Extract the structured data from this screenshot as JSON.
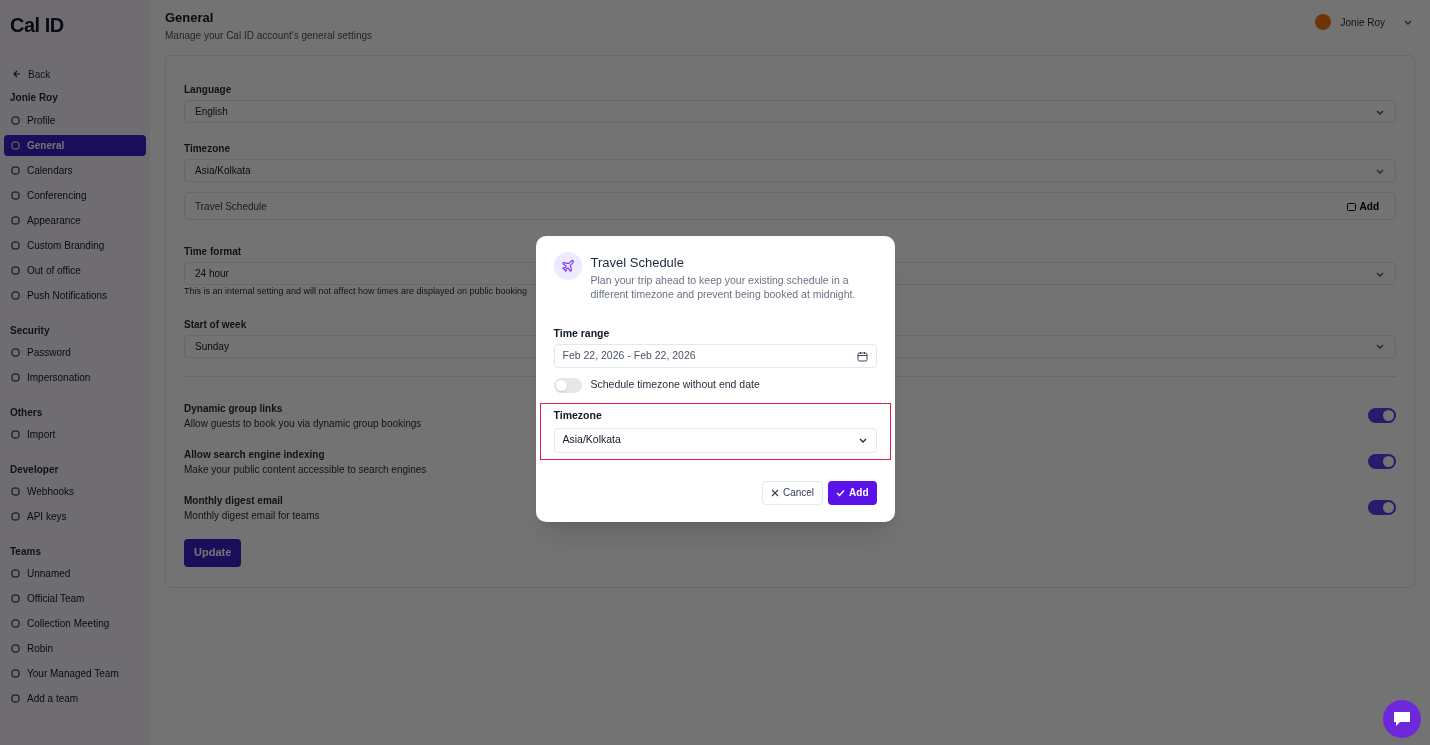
{
  "sidebar": {
    "logo": "Cal ID",
    "back": "Back",
    "user": "Jonie Roy",
    "sections": [
      {
        "items": [
          {
            "label": "Profile",
            "selected": false
          },
          {
            "label": "General",
            "selected": true
          },
          {
            "label": "Calendars",
            "selected": false
          },
          {
            "label": "Conferencing",
            "selected": false
          },
          {
            "label": "Appearance",
            "selected": false
          },
          {
            "label": "Custom Branding",
            "selected": false
          },
          {
            "label": "Out of office",
            "selected": false
          },
          {
            "label": "Push Notifications",
            "selected": false
          }
        ]
      },
      {
        "title": "Security",
        "items": [
          {
            "label": "Password",
            "selected": false
          },
          {
            "label": "Impersonation",
            "selected": false
          }
        ]
      },
      {
        "title": "Others",
        "items": [
          {
            "label": "Import",
            "selected": false
          }
        ]
      },
      {
        "title": "Developer",
        "items": [
          {
            "label": "Webhooks",
            "selected": false
          },
          {
            "label": "API keys",
            "selected": false
          }
        ]
      },
      {
        "title": "Teams",
        "items": [
          {
            "label": "Unnamed",
            "selected": false
          },
          {
            "label": "Official Team",
            "selected": false
          },
          {
            "label": "Collection Meeting",
            "selected": false
          },
          {
            "label": "Robin",
            "selected": false
          },
          {
            "label": "Your Managed Team",
            "selected": false
          },
          {
            "label": "Add a team",
            "selected": false
          }
        ]
      }
    ]
  },
  "header": {
    "title": "General",
    "subtitle": "Manage your Cal ID account's general settings",
    "user_name": "Jonie Roy"
  },
  "settings": [
    {
      "kind": "select",
      "label": "Language",
      "value": "English"
    },
    {
      "kind": "select",
      "label": "Timezone",
      "value": "Asia/Kolkata"
    },
    {
      "kind": "action_row",
      "label": "Travel Schedule",
      "button": "Add"
    },
    {
      "kind": "select",
      "label": "Time format",
      "value": "24 hour",
      "hint": "This is an internal setting and will not affect how times are displayed on public booking"
    },
    {
      "kind": "select",
      "label": "Start of week",
      "value": "Sunday"
    }
  ],
  "toggles": [
    {
      "title": "Dynamic group links",
      "description": "Allow guests to book you via dynamic group bookings",
      "on": true
    },
    {
      "title": "Allow search engine indexing",
      "description": "Make your public content accessible to search engines",
      "on": true
    },
    {
      "title": "Monthly digest email",
      "description": "Monthly digest email for teams",
      "on": true
    }
  ],
  "update_button": "Update",
  "dialog": {
    "title": "Travel Schedule",
    "description": "Plan your trip ahead to keep your existing schedule in a different timezone and prevent being booked at midnight.",
    "time_range": {
      "label": "Time range",
      "value": "Feb 22, 2026 - Feb 22, 2026"
    },
    "no_end_date": {
      "label": "Schedule timezone without end date",
      "on": false
    },
    "timezone": {
      "label": "Timezone",
      "value": "Asia/Kolkata",
      "highlighted": true
    },
    "cancel": "Cancel",
    "add": "Add"
  }
}
